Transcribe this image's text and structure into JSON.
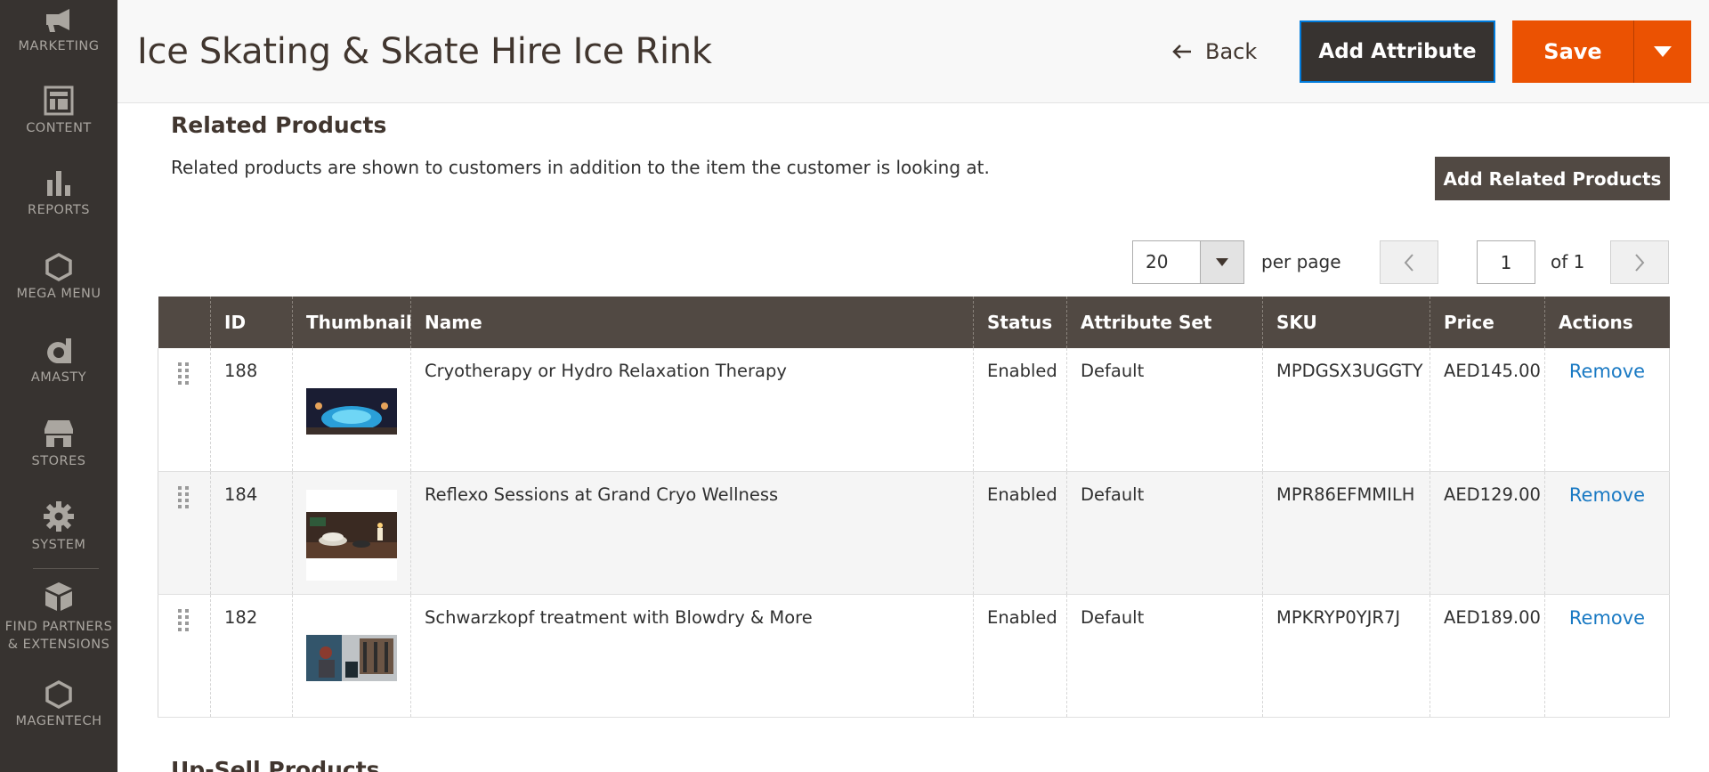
{
  "sidebar": {
    "items": [
      {
        "label": "MARKETING",
        "icon": "megaphone-icon"
      },
      {
        "label": "CONTENT",
        "icon": "layout-icon"
      },
      {
        "label": "REPORTS",
        "icon": "bar-chart-icon"
      },
      {
        "label": "MEGA MENU",
        "icon": "hexagon-icon"
      },
      {
        "label": "AMASTY",
        "icon": "amasty-logo-icon"
      },
      {
        "label": "STORES",
        "icon": "store-icon"
      },
      {
        "label": "SYSTEM",
        "icon": "gear-icon"
      },
      {
        "label": "FIND PARTNERS",
        "label2": "& EXTENSIONS",
        "icon": "cubes-icon"
      },
      {
        "label": "MAGENTECH",
        "icon": "hexagon-icon"
      }
    ]
  },
  "header": {
    "title": "Ice Skating & Skate Hire Ice Rink",
    "back_label": "Back",
    "add_attribute_label": "Add Attribute",
    "save_label": "Save"
  },
  "related": {
    "title": "Related Products",
    "description": "Related products are shown to customers in addition to the item the customer is looking at.",
    "add_button_label": "Add Related Products"
  },
  "pager": {
    "per_page_value": "20",
    "per_page_label": "per page",
    "current_page": "1",
    "of_label": "of 1"
  },
  "grid": {
    "columns": [
      "",
      "ID",
      "Thumbnail",
      "Name",
      "Status",
      "Attribute Set",
      "SKU",
      "Price",
      "Actions"
    ],
    "rows": [
      {
        "id": "188",
        "name": "Cryotherapy or Hydro Relaxation Therapy",
        "status": "Enabled",
        "attribute_set": "Default",
        "sku": "MPDGSX3UGGTY",
        "price": "AED145.00",
        "action": "Remove"
      },
      {
        "id": "184",
        "name": "Reflexo Sessions at Grand Cryo Wellness",
        "status": "Enabled",
        "attribute_set": "Default",
        "sku": "MPR86EFMMILH",
        "price": "AED129.00",
        "action": "Remove"
      },
      {
        "id": "182",
        "name": "Schwarzkopf treatment with Blowdry & More",
        "status": "Enabled",
        "attribute_set": "Default",
        "sku": "MPKRYP0YJR7J",
        "price": "AED189.00",
        "action": "Remove"
      }
    ]
  },
  "upsell": {
    "title": "Up-Sell Products"
  },
  "colors": {
    "sidebar_bg": "#373330",
    "save_orange": "#eb5202",
    "grid_header": "#514943",
    "link_blue": "#1979c3"
  }
}
